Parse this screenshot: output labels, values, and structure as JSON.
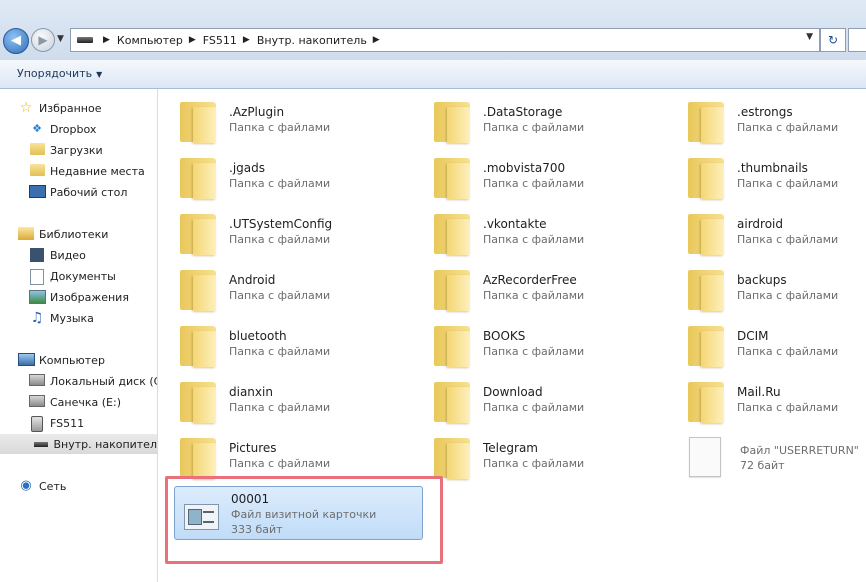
{
  "address": {
    "breadcrumbs": [
      "Компьютер",
      "FS511",
      "Внутр. накопитель"
    ]
  },
  "toolbar": {
    "organize_label": "Упорядочить"
  },
  "navigation": {
    "favorites": {
      "label": "Избранное",
      "items": [
        "Dropbox",
        "Загрузки",
        "Недавние места",
        "Рабочий стол"
      ]
    },
    "libraries": {
      "label": "Библиотеки",
      "items": [
        "Видео",
        "Документы",
        "Изображения",
        "Музыка"
      ]
    },
    "computer": {
      "label": "Компьютер",
      "items": [
        "Локальный диск (C",
        "Санечка (E:)",
        "FS511",
        "Внутр. накопител"
      ]
    },
    "network": {
      "label": "Сеть"
    }
  },
  "files": [
    {
      "name": ".AzPlugin",
      "type": "Папка с файлами"
    },
    {
      "name": ".DataStorage",
      "type": "Папка с файлами"
    },
    {
      "name": ".estrongs",
      "type": "Папка с файлами"
    },
    {
      "name": ".jgads",
      "type": "Папка с файлами"
    },
    {
      "name": ".mobvista700",
      "type": "Папка с файлами"
    },
    {
      "name": ".thumbnails",
      "type": "Папка с файлами"
    },
    {
      "name": ".UTSystemConfig",
      "type": "Папка с файлами"
    },
    {
      "name": ".vkontakte",
      "type": "Папка с файлами"
    },
    {
      "name": "airdroid",
      "type": "Папка с файлами"
    },
    {
      "name": "Android",
      "type": "Папка с файлами"
    },
    {
      "name": "AzRecorderFree",
      "type": "Папка с файлами"
    },
    {
      "name": "backups",
      "type": "Папка с файлами"
    },
    {
      "name": "bluetooth",
      "type": "Папка с файлами"
    },
    {
      "name": "BOOKS",
      "type": "Папка с файлами"
    },
    {
      "name": "DCIM",
      "type": "Папка с файлами"
    },
    {
      "name": "dianxin",
      "type": "Папка с файлами"
    },
    {
      "name": "Download",
      "type": "Папка с файлами"
    },
    {
      "name": "Mail.Ru",
      "type": "Папка с файлами"
    },
    {
      "name": "Pictures",
      "type": "Папка с файлами"
    },
    {
      "name": "Telegram",
      "type": "Папка с файлами"
    }
  ],
  "userreturn_file": {
    "type": "Файл \"USERRETURN\"",
    "size": "72 байт"
  },
  "selected_file": {
    "name": "00001",
    "type": "Файл визитной карточки",
    "size": "333 байт"
  },
  "colors": {
    "highlight_border": "#e8717c",
    "selection_fill": "#cde4fa",
    "folder_yellow": "#f4d673"
  },
  "icons": [
    "back-arrow-icon",
    "forward-arrow-icon",
    "refresh-icon",
    "star-icon",
    "dropbox-icon",
    "folder-icon",
    "computer-icon",
    "network-icon",
    "vcard-icon"
  ]
}
